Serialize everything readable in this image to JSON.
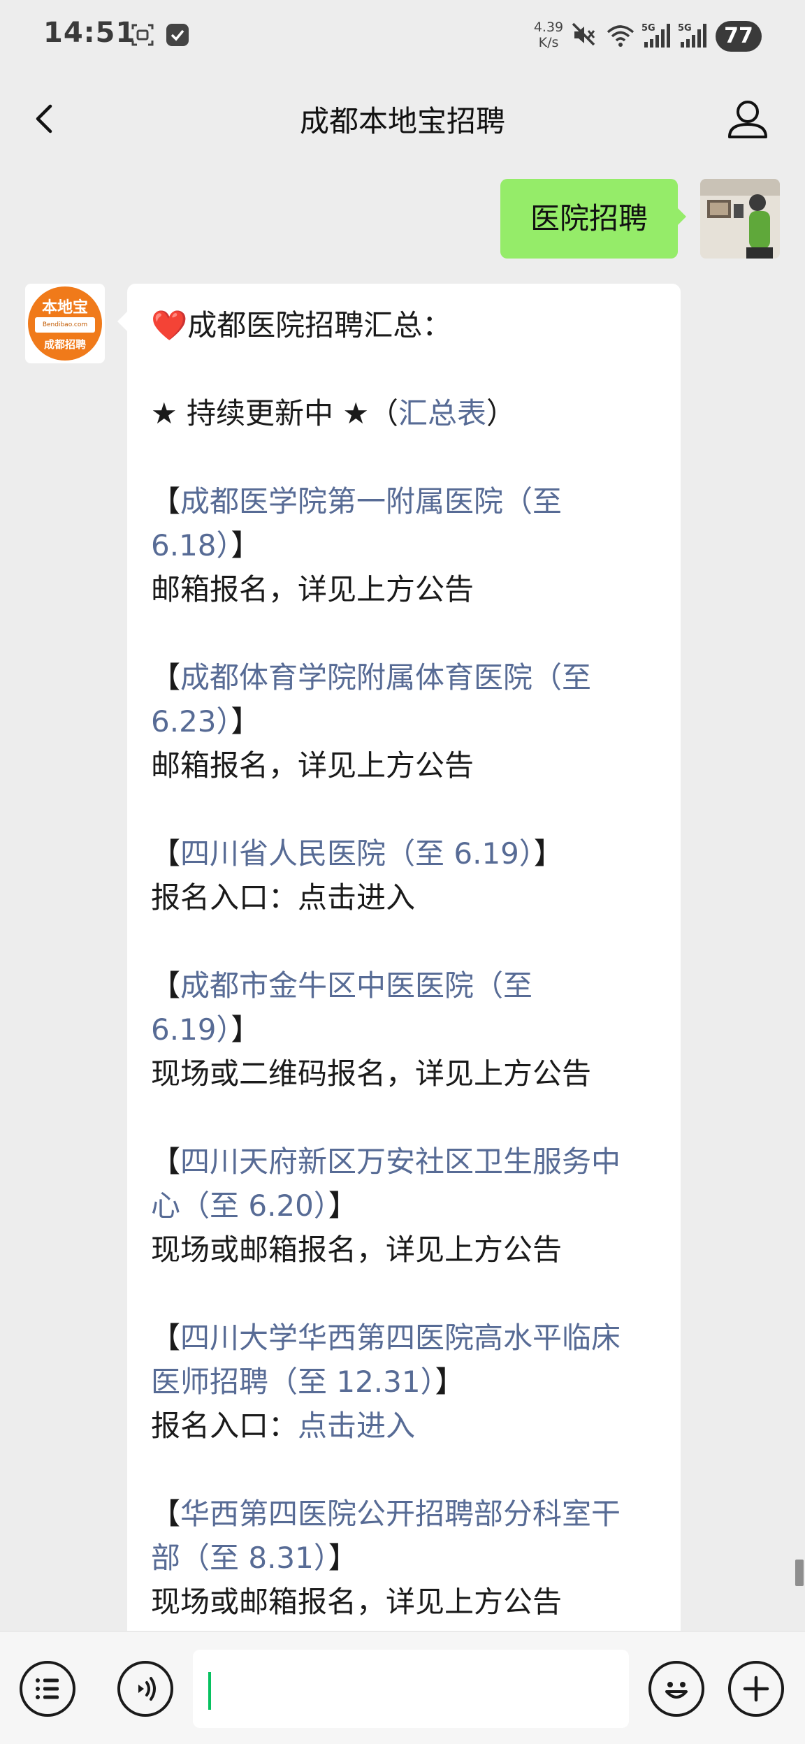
{
  "status_bar": {
    "time": "14:51",
    "net_speed_value": "4.39",
    "net_speed_unit": "K/s",
    "battery": "77",
    "icons": [
      "screenshot-icon",
      "checkbox-icon",
      "mute-icon",
      "wifi-icon",
      "signal-5g-icon",
      "signal-5g-icon"
    ]
  },
  "nav": {
    "title": "成都本地宝招聘",
    "back_icon": "chevron-left-icon",
    "profile_icon": "person-icon"
  },
  "messages": {
    "sent_text": "医院招聘",
    "logo": {
      "top": "本地宝",
      "url": "Bendibao.com",
      "bottom": "成都招聘"
    },
    "reply": {
      "heart": "❤️",
      "title": "成都医院招聘汇总：",
      "updating_prefix": "★ 持续更新中 ★（",
      "updating_link": "汇总表",
      "updating_suffix": "）",
      "bracket_open": "【",
      "bracket_close": "】",
      "items": [
        {
          "link1": "成都医学院第一附属医院（至",
          "link2": "6.18）",
          "detail": "邮箱报名，详见上方公告"
        },
        {
          "link1": "成都体育学院附属体育医院（至",
          "link2": "6.23）",
          "detail": "邮箱报名，详见上方公告"
        },
        {
          "link1": "四川省人民医院（至 6.19）",
          "detail": "报名入口：点击进入"
        },
        {
          "link1": "成都市金牛区中医医院（至",
          "link2": "6.19）",
          "detail": "现场或二维码报名，详见上方公告"
        },
        {
          "link1": "四川天府新区万安社区卫生服务中",
          "link2": "心（至 6.20）",
          "detail": "现场或邮箱报名，详见上方公告"
        },
        {
          "link1": "四川大学华西第四医院高水平临床",
          "link2": "医师招聘（至 12.31）",
          "detail_prefix": "报名入口：",
          "detail_link": "点击进入"
        },
        {
          "link1": "华西第四医院公开招聘部分科室干",
          "link2": "部（至 8.31）",
          "detail": "现场或邮箱报名，详见上方公告"
        }
      ]
    }
  },
  "input_bar": {
    "menu_icon": "list-menu-icon",
    "voice_icon": "voice-icon",
    "emoji_icon": "emoji-icon",
    "add_icon": "plus-icon",
    "input_value": ""
  },
  "colors": {
    "sent_bubble": "#95ec69",
    "link": "#576b95",
    "logo_orange": "#f07a1a",
    "cursor": "#07c160"
  }
}
